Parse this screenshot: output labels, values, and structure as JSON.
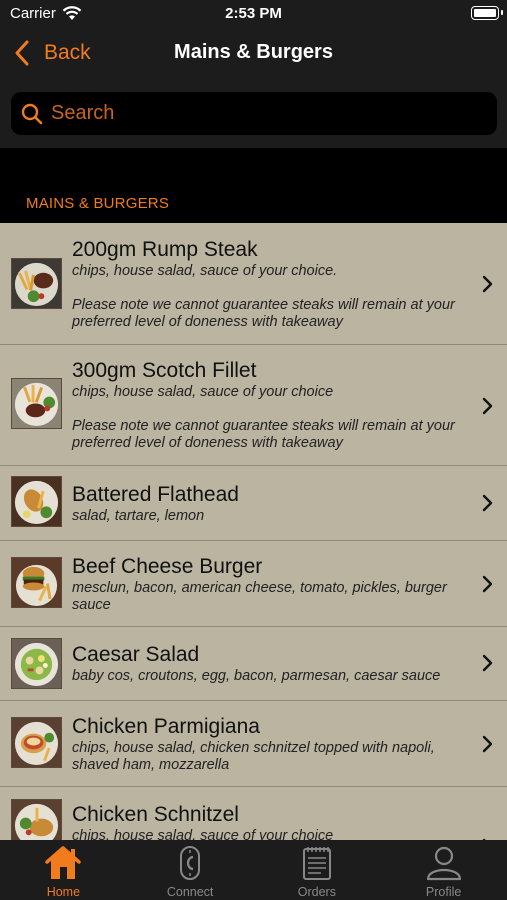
{
  "status": {
    "carrier": "Carrier",
    "time": "2:53 PM"
  },
  "nav": {
    "back_label": "Back",
    "title": "Mains & Burgers"
  },
  "search": {
    "placeholder": "Search"
  },
  "section": {
    "header": "MAINS & BURGERS"
  },
  "items": [
    {
      "name": "200gm Rump Steak",
      "description": "chips, house salad, sauce of your choice.",
      "note": "Please note we cannot guarantee steaks will remain at your preferred level of doneness with takeaway"
    },
    {
      "name": "300gm Scotch Fillet",
      "description": "chips, house salad, sauce of your choice",
      "note": "Please note we cannot guarantee steaks will remain at your preferred level of doneness with takeaway"
    },
    {
      "name": "Battered Flathead",
      "description": "salad, tartare, lemon"
    },
    {
      "name": "Beef Cheese Burger",
      "description": "mesclun, bacon, american cheese, tomato, pickles, burger sauce"
    },
    {
      "name": "Caesar Salad",
      "description": "baby cos, croutons, egg, bacon, parmesan, caesar sauce"
    },
    {
      "name": "Chicken Parmigiana",
      "description": "chips, house salad, chicken schnitzel topped with napoli, shaved ham, mozzarella"
    },
    {
      "name": "Chicken Schnitzel",
      "description": "chips, house salad, sauce of your choice"
    }
  ],
  "tabs": [
    {
      "label": "Home",
      "icon": "home-icon",
      "active": true
    },
    {
      "label": "Connect",
      "icon": "connect-icon",
      "active": false
    },
    {
      "label": "Orders",
      "icon": "orders-icon",
      "active": false
    },
    {
      "label": "Profile",
      "icon": "profile-icon",
      "active": false
    }
  ],
  "colors": {
    "accent": "#f07c1e",
    "list_background": "#bab4a1",
    "bar_background": "#1c1c1c"
  }
}
